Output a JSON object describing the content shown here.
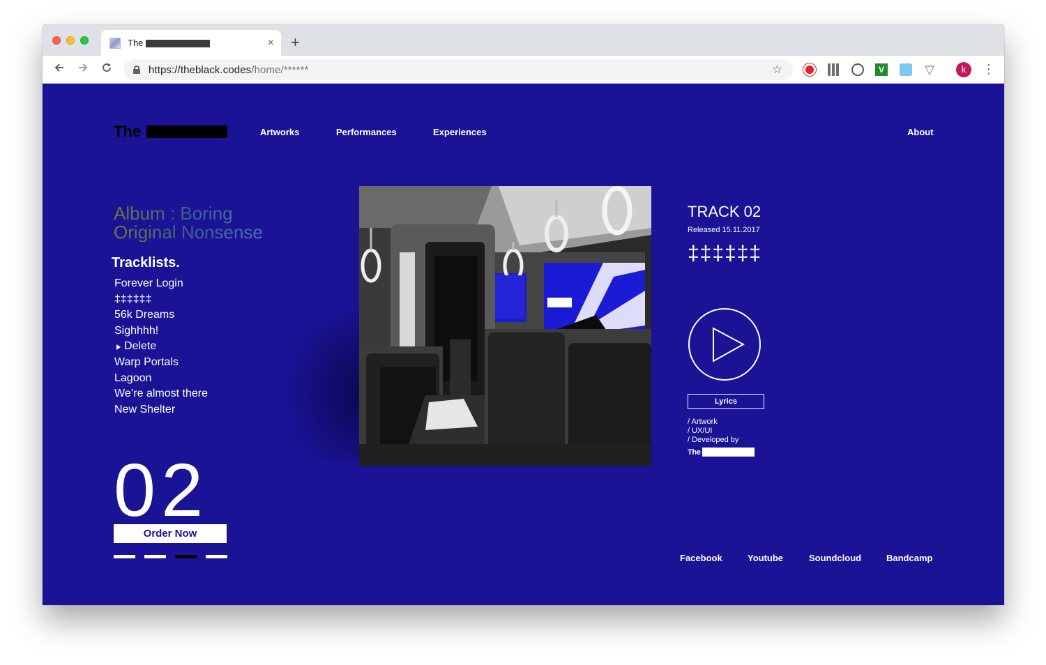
{
  "browser": {
    "tab_title": "The",
    "tab_close": "×",
    "new_tab": "+",
    "url_host": "https://theblack.codes",
    "url_path": "/home/******",
    "profile_initial": "k",
    "icons": [
      "back-arrow-icon",
      "forward-arrow-icon",
      "reload-icon",
      "lock-icon",
      "star-icon",
      "menu-dots-icon"
    ]
  },
  "site": {
    "logo_text": "The",
    "nav": {
      "artworks": "Artworks",
      "performances": "Performances",
      "experiences": "Experiences",
      "about": "About"
    },
    "album_title": "Album : Boring Original Nonsense",
    "tracklists_heading": "Tracklists.",
    "tracks": [
      "Forever Login",
      "‡‡‡‡‡‡",
      "56k Dreams",
      "Sighhhh!",
      "Delete",
      "Warp Portals",
      "Lagoon",
      "We’re almost there",
      "New Shelter"
    ],
    "active_track_index": 4,
    "big_number": "02",
    "order_button": "Order Now",
    "pager_active_index": 2,
    "track": {
      "title": "TRACK 02",
      "released": "Released 15.11.2017",
      "code": "‡‡‡‡‡‡"
    },
    "lyrics_button": "Lyrics",
    "credits": {
      "artwork": "/ Artwork",
      "uxui": "/ UX/UI",
      "developed_by": "/ Developed by",
      "studio": "The"
    },
    "social": {
      "facebook": "Facebook",
      "youtube": "Youtube",
      "soundcloud": "Soundcloud",
      "bandcamp": "Bandcamp"
    },
    "colors": {
      "background": "#1a1396",
      "text": "#ffffff"
    }
  }
}
